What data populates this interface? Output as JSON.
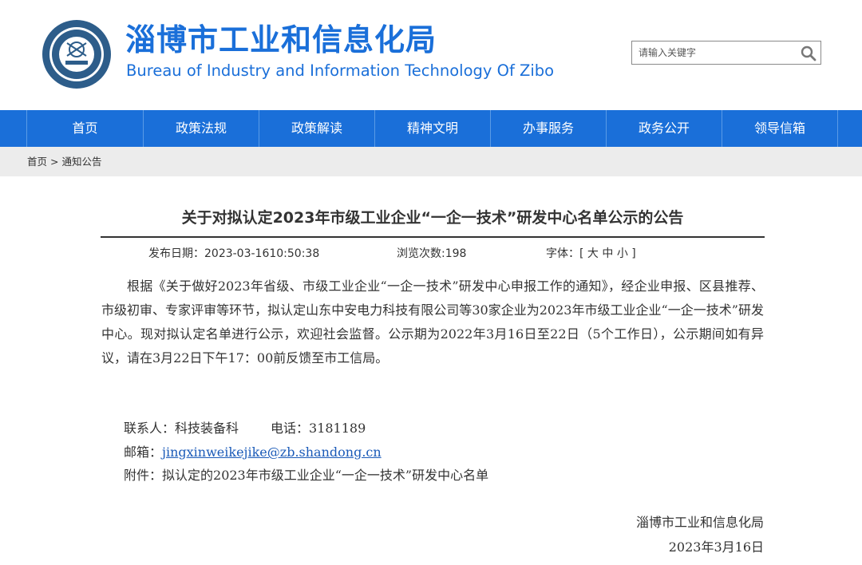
{
  "header": {
    "title": "淄博市工业和信息化局",
    "subtitle": "Bureau of Industry and Information Technology Of Zibo",
    "search_placeholder": "请输入关键字",
    "search_icon": "search-icon",
    "logo_icon": "seal-logo-icon"
  },
  "nav": {
    "items": [
      {
        "label": "首页"
      },
      {
        "label": "政策法规"
      },
      {
        "label": "政策解读"
      },
      {
        "label": "精神文明"
      },
      {
        "label": "办事服务"
      },
      {
        "label": "政务公开"
      },
      {
        "label": "领导信箱"
      }
    ]
  },
  "breadcrumb": {
    "home": "首页",
    "separator": ">",
    "current": "通知公告"
  },
  "article": {
    "title": "关于对拟认定2023年市级工业企业“一企一技术”研发中心名单公示的公告",
    "publish_label": "发布日期：",
    "publish_date": "2023-03-1610:50:38",
    "views_label": "浏览次数:",
    "views": "198",
    "font_label": "字体：[",
    "font_large": "大",
    "font_medium": "中",
    "font_small": "小",
    "font_close": "]",
    "body": "根据《关于做好2023年省级、市级工业企业“一企一技术”研发中心申报工作的通知》，经企业申报、区县推荐、市级初审、专家评审等环节，拟认定山东中安电力科技有限公司等30家企业为2023年市级工业企业“一企一技术”研发中心。现对拟认定名单进行公示，欢迎社会监督。公示期为2022年3月16日至22日（5个工作日），公示期间如有异议，请在3月22日下午17：00前反馈至市工信局。",
    "contact_label": "联系人：科技装备科",
    "phone_label": "电话：3181189",
    "email_label": "邮箱：",
    "email": "jingxinweikejike@zb.shandong.cn",
    "attachment_label": "附件：",
    "attachment": "拟认定的2023年市级工业企业“一企一技术”研发中心名单",
    "sign_org": "淄博市工业和信息化局",
    "sign_date": "2023年3月16日"
  },
  "colors": {
    "brand_blue": "#1a6fd9",
    "breadcrumb_bg": "#ececec",
    "link": "#1a5ab8"
  }
}
